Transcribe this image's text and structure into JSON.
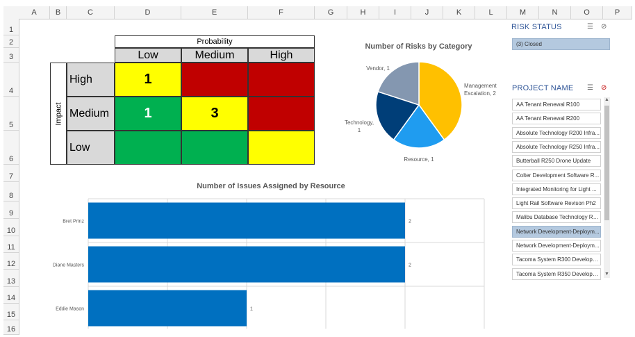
{
  "columns": [
    "A",
    "B",
    "C",
    "D",
    "E",
    "F",
    "G",
    "H",
    "I",
    "J",
    "K",
    "L",
    "M",
    "N",
    "O",
    "P"
  ],
  "rows": [
    "1",
    "2",
    "3",
    "4",
    "5",
    "6",
    "7",
    "8",
    "9",
    "10",
    "11",
    "12",
    "13",
    "14",
    "15",
    "16"
  ],
  "matrix": {
    "title": "Probability",
    "col_headers": [
      "Low",
      "Medium",
      "High"
    ],
    "axis_label": "Impact",
    "row_headers": [
      "High",
      "Medium",
      "Low"
    ],
    "cells": [
      [
        "1",
        "",
        ""
      ],
      [
        "1",
        "3",
        ""
      ],
      [
        "",
        "",
        ""
      ]
    ],
    "cell_colors": [
      [
        "#ffff00",
        "#c00000",
        "#c00000"
      ],
      [
        "#00b050",
        "#ffff00",
        "#c00000"
      ],
      [
        "#00b050",
        "#00b050",
        "#ffff00"
      ]
    ]
  },
  "pie": {
    "chart_data": {
      "type": "pie",
      "title": "Number of Risks by Category",
      "categories": [
        "Management Escalation",
        "Resource",
        "Technology",
        "Vendor"
      ],
      "values": [
        2,
        1,
        1,
        1
      ],
      "colors": [
        "#ffc000",
        "#1f9cf0",
        "#003e78",
        "#8497b0"
      ],
      "labels": [
        "Management Escalation, 2",
        "Resource, 1",
        "Technology, 1",
        "Vendor, 1"
      ]
    }
  },
  "bar": {
    "chart_data": {
      "type": "bar",
      "orientation": "horizontal",
      "title": "Number of Issues Assigned by Resource",
      "categories": [
        "Bret Prinz",
        "Diane Masters",
        "Eddie Mason"
      ],
      "values": [
        2,
        2,
        1
      ],
      "data_labels": [
        "2",
        "2",
        "1"
      ],
      "xlim": [
        0,
        2.5
      ],
      "grid": true,
      "color": "#0070c0"
    }
  },
  "slicers": {
    "risk_status": {
      "title": "RISK STATUS",
      "items": [
        "(3) Closed"
      ],
      "selected": [
        0
      ]
    },
    "project_name": {
      "title": "PROJECT NAME",
      "items": [
        "AA Tenant Renewal R100",
        "AA Tenant Renewal R200",
        "Absolute Technology R200 Infra...",
        "Absolute Technology R250 Infra...",
        "Butterball R250 Drone Update",
        "Colter Development Software R...",
        "Integrated Monitoring for Light ...",
        "Light Rail Software Revison Ph2",
        "Malibu Database Technology R1...",
        "Network Development-Deploym...",
        "Network Development-Deploym...",
        "Tacoma System R300 Developm...",
        "Tacoma System R350 Developm..."
      ],
      "selected": [
        9
      ]
    }
  }
}
